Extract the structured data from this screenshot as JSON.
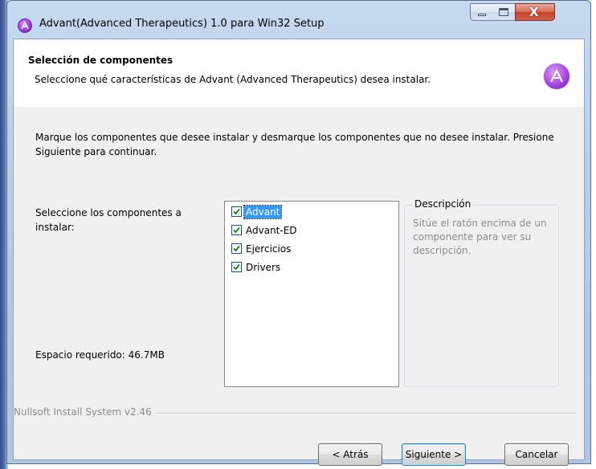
{
  "window": {
    "title": "Advant(Advanced Therapeutics) 1.0 para Win32 Setup",
    "controls": {
      "minimize": "minimize",
      "maximize": "maximize",
      "close": "X"
    }
  },
  "header": {
    "title": "Selección de componentes",
    "subtitle": "Seleccione qué características de Advant (Advanced Therapeutics) desea instalar.",
    "logo_icon": "advant-logo-icon"
  },
  "body": {
    "intro": "Marque los componentes que desee instalar y desmarque los componentes que no desee instalar. Presione Siguiente para continuar.",
    "select_label": "Seleccione los componentes a instalar:",
    "space_label": "Espacio requerido: 46.7MB",
    "components": [
      {
        "label": "Advant",
        "checked": true,
        "selected": true
      },
      {
        "label": "Advant-ED",
        "checked": true,
        "selected": false
      },
      {
        "label": "Ejercicios",
        "checked": true,
        "selected": false
      },
      {
        "label": "Drivers",
        "checked": true,
        "selected": false
      }
    ],
    "description": {
      "title": "Descripción",
      "text": "Sitúe el ratón encima de un componente para ver su descripción."
    },
    "branding": "Nullsoft Install System v2.46"
  },
  "buttons": {
    "back": "< Atrás",
    "next": "Siguiente >",
    "cancel": "Cancelar"
  },
  "colors": {
    "selection": "#3399ff",
    "logo": "#9a3ad6",
    "disabled_text": "#8c8c8c"
  }
}
